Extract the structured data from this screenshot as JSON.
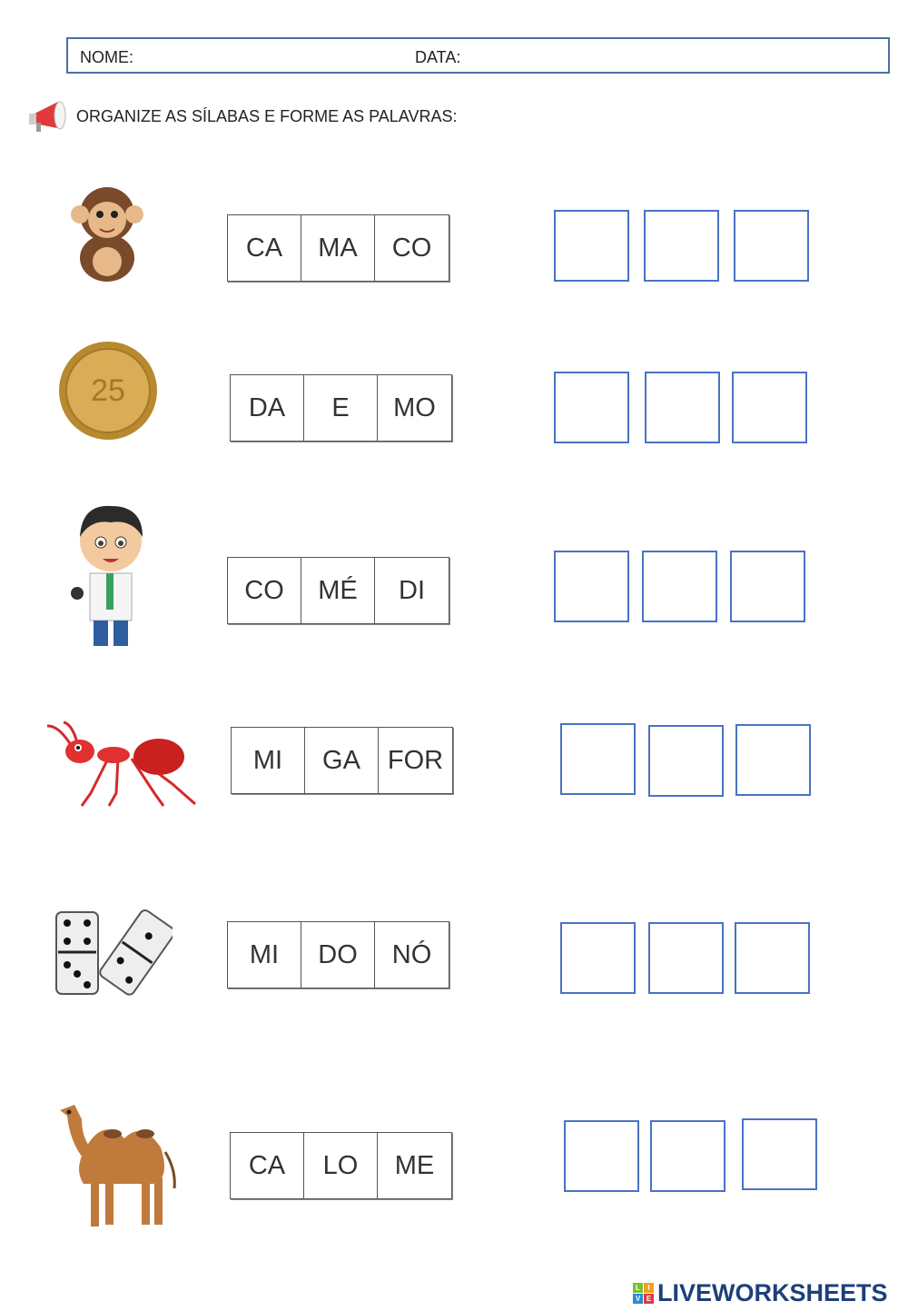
{
  "header": {
    "name_label": "NOME:",
    "date_label": "DATA:"
  },
  "instruction": {
    "icon": "megaphone-icon",
    "text": "ORGANIZE AS SÍLABAS E FORME AS PALAVRAS:"
  },
  "rows": [
    {
      "image": "monkey",
      "syllables": [
        "CA",
        "MA",
        "CO"
      ]
    },
    {
      "image": "coin",
      "syllables": [
        "DA",
        "E",
        "MO"
      ]
    },
    {
      "image": "doctor",
      "syllables": [
        "CO",
        "MÉ",
        "DI"
      ]
    },
    {
      "image": "ant",
      "syllables": [
        "MI",
        "GA",
        "FOR"
      ]
    },
    {
      "image": "dominoes",
      "syllables": [
        "MI",
        "DO",
        "NÓ"
      ]
    },
    {
      "image": "camel",
      "syllables": [
        "CA",
        "LO",
        "ME"
      ]
    }
  ],
  "colors": {
    "answer_border": "#4a72c4",
    "header_border": "#4a6fa5",
    "logo": "#1d3f7a"
  },
  "footer": {
    "logo_text": "LIVEWORKSHEETS",
    "logo_letters": [
      "L",
      "I",
      "V",
      "E"
    ]
  }
}
